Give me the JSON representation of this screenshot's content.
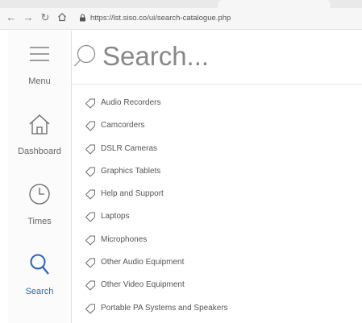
{
  "browser": {
    "url": "https://lst.siso.co/ui/search-catalogue.php",
    "back_icon": "arrow-left-icon",
    "forward_icon": "arrow-right-icon",
    "reload_icon": "reload-icon",
    "home_icon": "home-icon"
  },
  "sidebar": {
    "items": [
      {
        "label": "Menu",
        "icon": "hamburger-icon",
        "active": false
      },
      {
        "label": "Dashboard",
        "icon": "house-icon",
        "active": false
      },
      {
        "label": "Times",
        "icon": "clock-icon",
        "active": false
      },
      {
        "label": "Search",
        "icon": "magnifier-icon",
        "active": true
      }
    ]
  },
  "search": {
    "placeholder": "Search...",
    "value": ""
  },
  "categories": [
    "Audio Recorders",
    "Camcorders",
    "DSLR Cameras",
    "Graphics Tablets",
    "Help and Support",
    "Laptops",
    "Microphones",
    "Other Audio Equipment",
    "Other Video Equipment",
    "Portable PA Systems and Speakers"
  ],
  "colors": {
    "accent": "#2c63b8",
    "icon_gray": "#666666"
  }
}
